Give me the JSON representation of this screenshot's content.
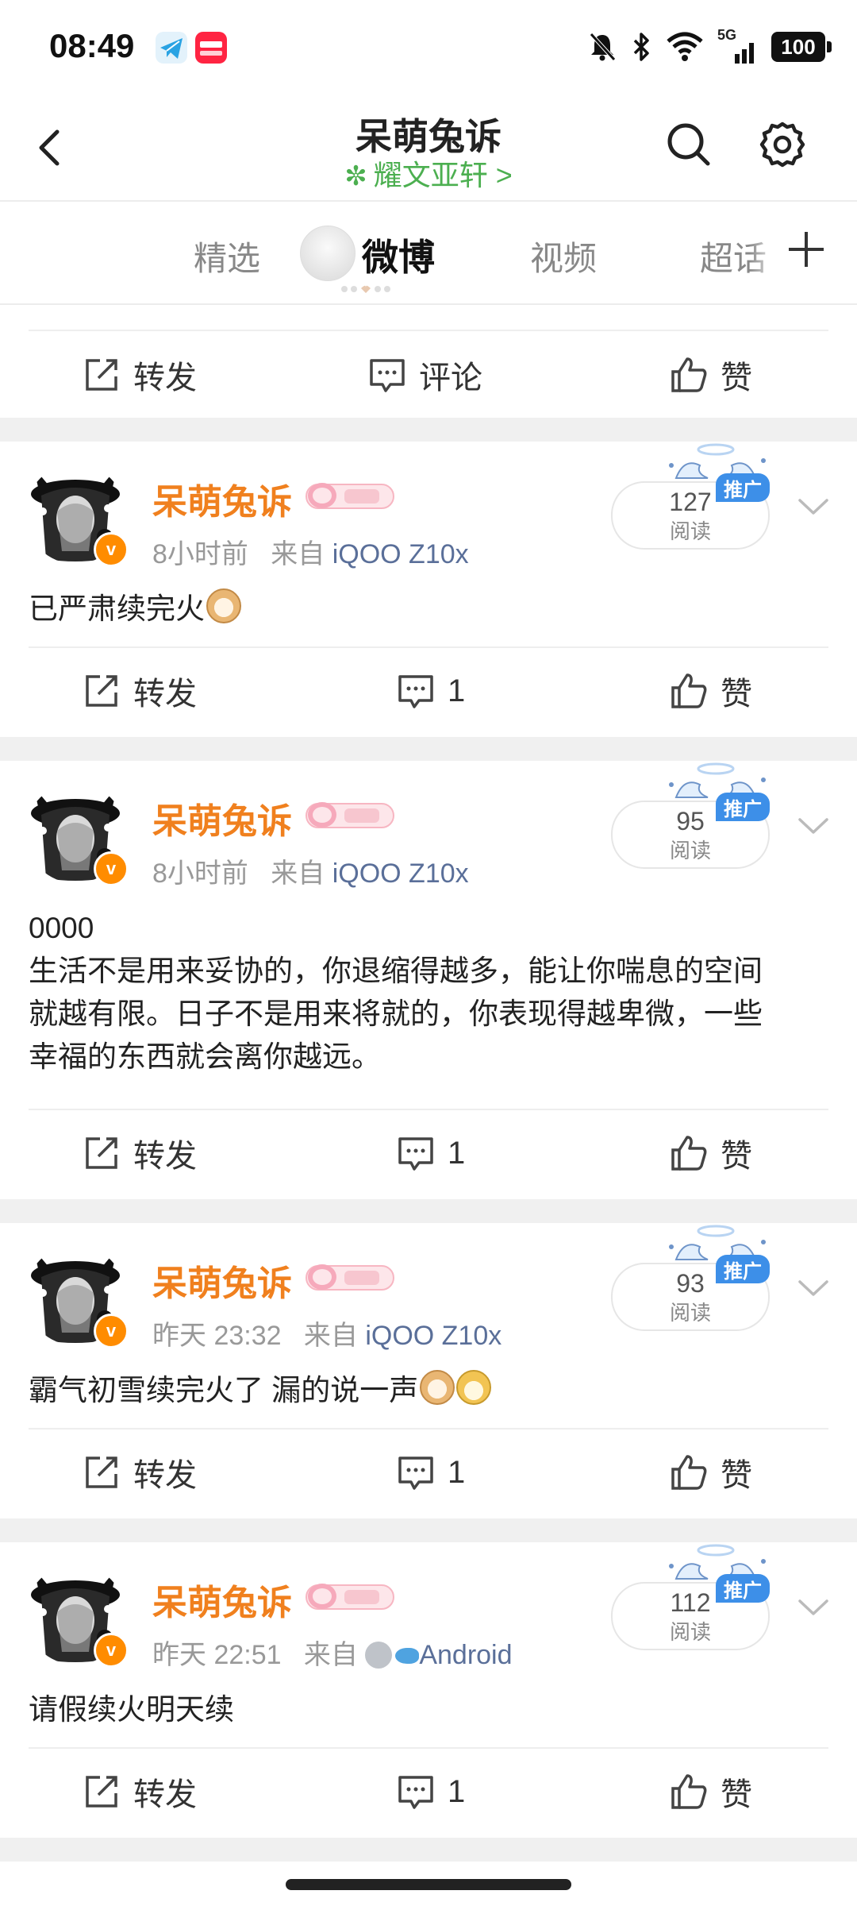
{
  "status_bar": {
    "time": "08:49",
    "app_icons": [
      "telegram-icon",
      "xiaohongshu-icon"
    ],
    "network": "5G",
    "battery": "100",
    "icons": [
      "mute-bell-icon",
      "bluetooth-icon",
      "wifi-icon",
      "signal-icon",
      "battery-icon"
    ]
  },
  "header": {
    "title": "呆萌兔诉",
    "subtitle": "耀文亚轩 >",
    "back_icon": "back-icon",
    "search_icon": "search-icon",
    "settings_icon": "settings-icon"
  },
  "tabs": {
    "items": [
      {
        "label": "精选",
        "active": false
      },
      {
        "label": "微博",
        "active": true
      },
      {
        "label": "视频",
        "active": false
      },
      {
        "label": "超话",
        "active": false
      }
    ],
    "add_icon": "plus-icon"
  },
  "actions": {
    "repost": "转发",
    "comment": "评论",
    "like": "赞"
  },
  "posts": [
    {
      "username": "呆萌兔诉",
      "time": "8小时前",
      "source_prefix": "来自",
      "source": "iQOO Z10x",
      "reads": "127",
      "read_label": "阅读",
      "promo": "推广",
      "content_lines": [
        "已严肃续完火"
      ],
      "comments": "1"
    },
    {
      "username": "呆萌兔诉",
      "time": "8小时前",
      "source_prefix": "来自",
      "source": "iQOO Z10x",
      "reads": "95",
      "read_label": "阅读",
      "promo": "推广",
      "content_lines": [
        "0000",
        "生活不是用来妥协的，你退缩得越多，能让你喘息的空间",
        "就越有限。日子不是用来将就的，你表现得越卑微，一些",
        "幸福的东西就会离你越远。"
      ],
      "comments": "1"
    },
    {
      "username": "呆萌兔诉",
      "time": "昨天 23:32",
      "source_prefix": "来自",
      "source": "iQOO Z10x",
      "reads": "93",
      "read_label": "阅读",
      "promo": "推广",
      "content_lines": [
        "霸气初雪续完火了  漏的说一声"
      ],
      "comments": "1"
    },
    {
      "username": "呆萌兔诉",
      "time": "昨天 22:51",
      "source_prefix": "来自",
      "source": "Android",
      "reads": "112",
      "read_label": "阅读",
      "promo": "推广",
      "content_lines": [
        "请假续火明天续"
      ],
      "comments": "1"
    }
  ],
  "colors": {
    "username": "#f0801e",
    "subtitle": "#4caf50",
    "device": "#5a6f99",
    "promo": "#3d8fe8",
    "separator": "#f0f0f0"
  }
}
